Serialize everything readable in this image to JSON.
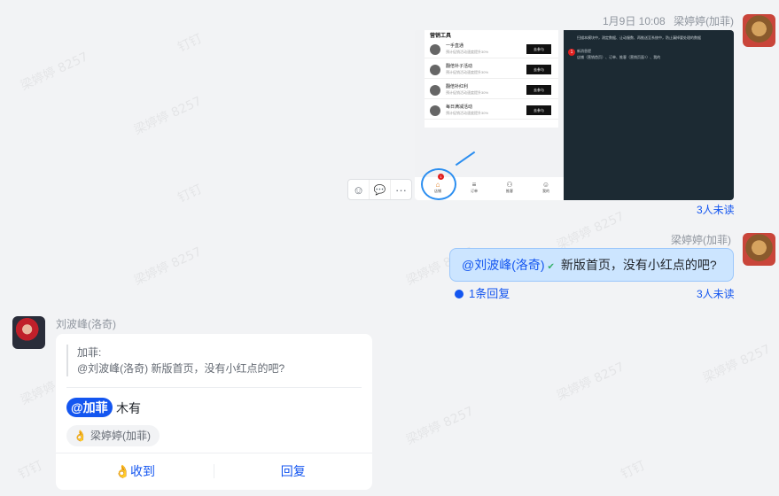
{
  "message1": {
    "timestamp": "1月9日  10:08",
    "sender": "梁婷婷(加菲)",
    "unread": "3人未读",
    "screenshot": {
      "panel_title": "营销工具",
      "tools": [
        {
          "name": "一手直通",
          "desc": "预计促销活动速度提升30%",
          "action": "去参与"
        },
        {
          "name": "翻倍补子活动",
          "desc": "预计促销活动速度提升30%",
          "action": "去参与"
        },
        {
          "name": "翻倍补红利",
          "desc": "预计促销活动速度提升30%",
          "action": "去参与"
        },
        {
          "name": "每日满减活动",
          "desc": "预计促销活动速度提升30%",
          "action": "去参与"
        }
      ],
      "tabs": [
        {
          "icon": "⌂",
          "label": "店铺"
        },
        {
          "icon": "≡",
          "label": "订单"
        },
        {
          "icon": "⚇",
          "label": "推客"
        },
        {
          "icon": "☺",
          "label": "我的"
        }
      ],
      "badge": "1",
      "notes": [
        "扫描本模块中，测定数据、让动服数、再推送至系统中，防止漏掉要处理的数据",
        "新消息提",
        "店铺（营销首页）、订单、推客（营销页面?）、我的"
      ]
    },
    "actions": [
      {
        "icon": "emoji-icon",
        "glyph": "☺"
      },
      {
        "icon": "reply-icon",
        "glyph": "💬"
      },
      {
        "icon": "more-icon",
        "glyph": "···"
      }
    ]
  },
  "message2": {
    "sender": "梁婷婷(加菲)",
    "mention": "@刘波峰(洛奇)",
    "text": " 新版首页，没有小红点的吧?",
    "unread": "3人未读",
    "reply_link": "1条回复"
  },
  "message3": {
    "sender": "刘波峰(洛奇)",
    "quote_author": "加菲:",
    "quote_text": "@刘波峰(洛奇) 新版首页，没有小红点的吧?",
    "mention": "@加菲",
    "text": "木有",
    "reaction": "梁婷婷(加菲)",
    "received_label": "收到",
    "reply_label": "回复"
  },
  "watermark": "梁婷婷 8257",
  "watermark_short": "钉钉"
}
